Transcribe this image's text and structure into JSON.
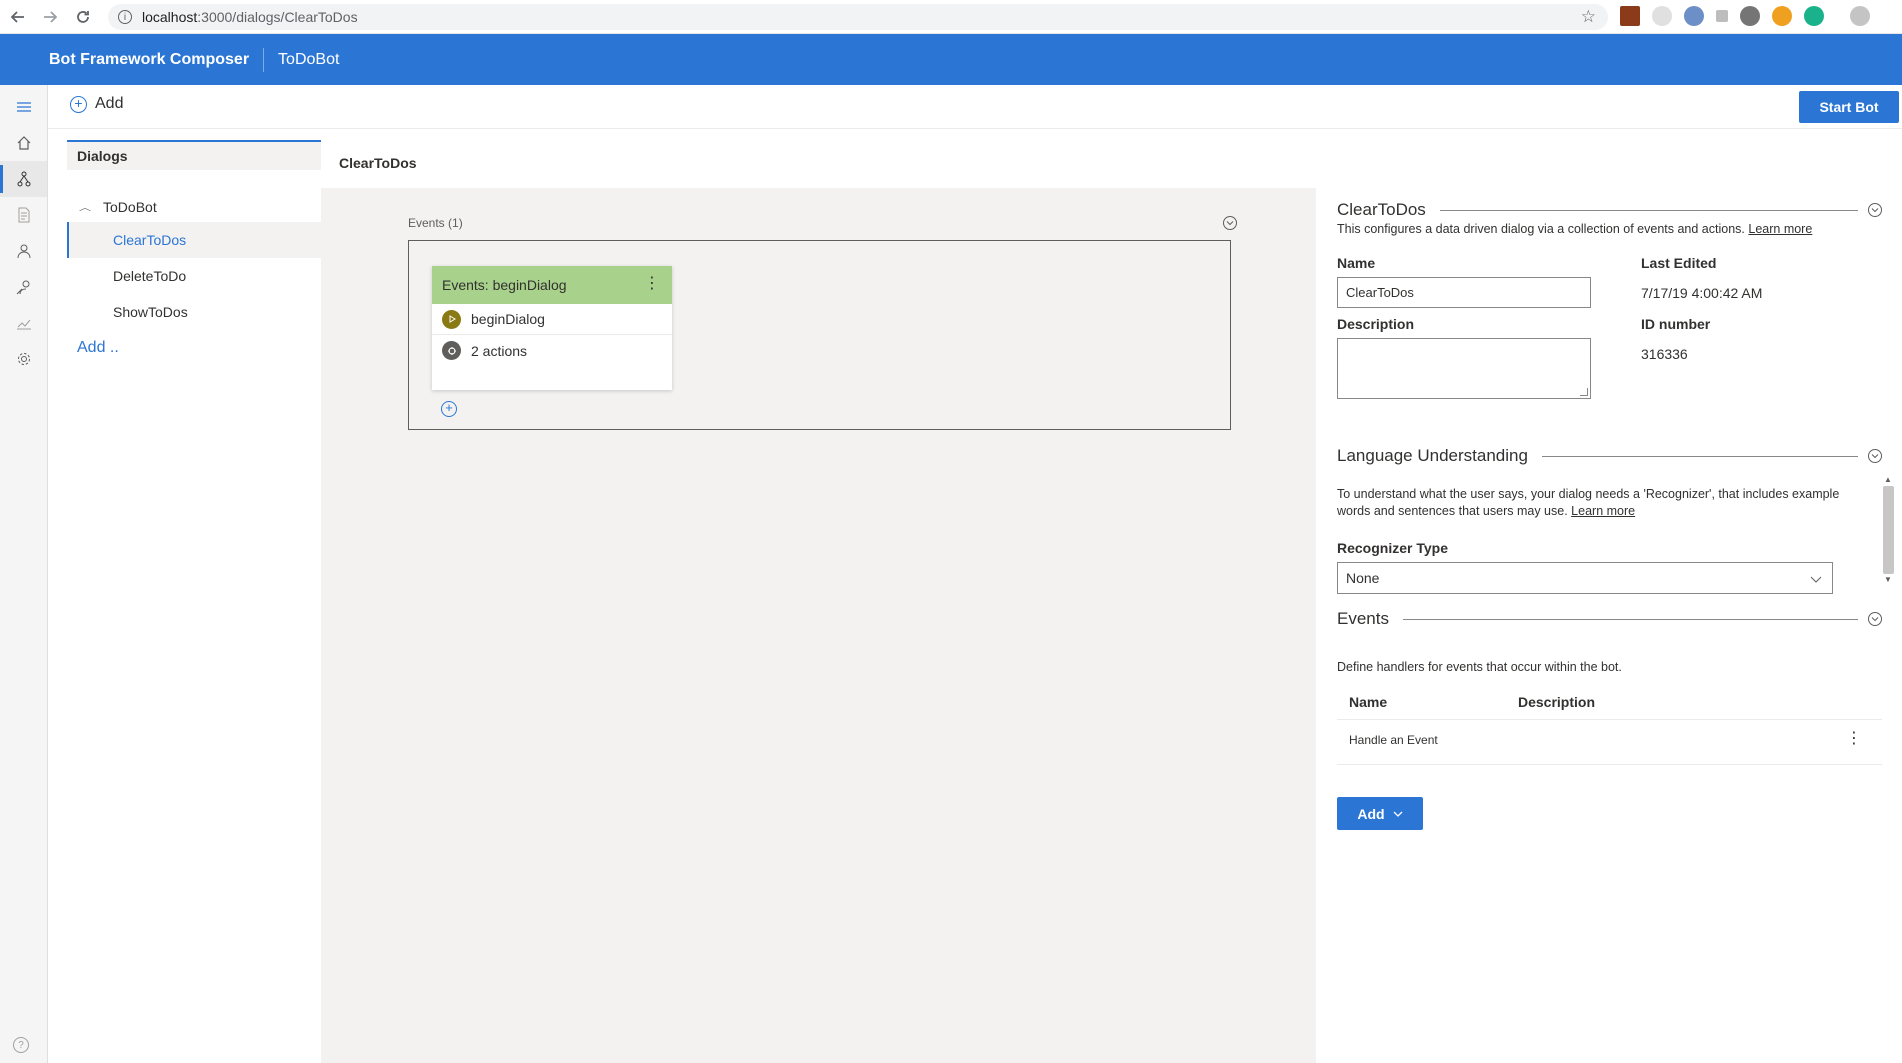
{
  "browser": {
    "url_host": "localhost",
    "url_path": ":3000/dialogs/ClearToDos",
    "info_glyph": "i"
  },
  "header": {
    "app_title": "Bot Framework Composer",
    "bot_name": "ToDoBot",
    "accent_color": "#2b76d5"
  },
  "rail": {
    "items": [
      "hamburger-icon",
      "home-icon",
      "flow-icon",
      "document-icon",
      "bot-icon",
      "users-icon",
      "chart-icon",
      "gear-icon"
    ],
    "help_glyph": "?"
  },
  "toolbar": {
    "add_label": "Add",
    "start_bot_label": "Start Bot"
  },
  "dialogs": {
    "header": "Dialogs",
    "root": "ToDoBot",
    "items": [
      "ClearToDos",
      "DeleteToDo",
      "ShowToDos"
    ],
    "add_label": "Add .."
  },
  "canvas": {
    "title": "ClearToDos",
    "events_label": "Events (1)",
    "card": {
      "header": "Events: beginDialog",
      "rows": [
        "beginDialog",
        "2 actions"
      ],
      "header_color": "#a8d18b"
    }
  },
  "panel": {
    "dialog": {
      "title": "ClearToDos",
      "description": "This configures a data driven dialog via a collection of events and actions.",
      "learn_more": "Learn more",
      "name_label": "Name",
      "name_value": "ClearToDos",
      "description_label": "Description",
      "description_value": "",
      "last_edited_label": "Last Edited",
      "last_edited_value": "7/17/19 4:00:42 AM",
      "id_label": "ID number",
      "id_value": "316336"
    },
    "language": {
      "title": "Language Understanding",
      "description": "To understand what the user says, your dialog needs a 'Recognizer', that includes example words and sentences that users may use.",
      "learn_more": "Learn more",
      "recognizer_label": "Recognizer Type",
      "recognizer_value": "None"
    },
    "events": {
      "title": "Events",
      "description": "Define handlers for events that occur within the bot.",
      "col_name": "Name",
      "col_description": "Description",
      "rows": [
        {
          "name": "Handle an Event",
          "description": ""
        }
      ],
      "add_label": "Add"
    }
  }
}
